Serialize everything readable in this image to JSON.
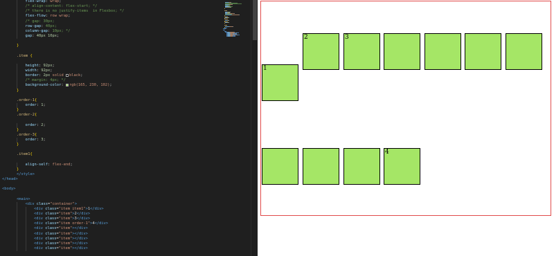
{
  "editor": {
    "lines": [
      {
        "indent": 2,
        "parts": [
          [
            "prop",
            "flex-wrap"
          ],
          [
            "pun",
            ": "
          ],
          [
            "val",
            "wrap"
          ],
          [
            "pun",
            ";"
          ]
        ]
      },
      {
        "indent": 2,
        "parts": [
          [
            "com",
            "/* align-content: flex-start; */"
          ]
        ]
      },
      {
        "indent": 2,
        "parts": [
          [
            "com",
            "/* there is no justify-items  in Flexbox; */"
          ]
        ]
      },
      {
        "indent": 2,
        "parts": [
          [
            "prop",
            "flex-flow"
          ],
          [
            "pun",
            ": "
          ],
          [
            "val",
            "row wrap"
          ],
          [
            "pun",
            ";"
          ]
        ]
      },
      {
        "indent": 2,
        "parts": [
          [
            "com",
            "/* gap: 30px;"
          ]
        ]
      },
      {
        "indent": 2,
        "parts": [
          [
            "prop",
            "row-gap"
          ],
          [
            "pun",
            ": "
          ],
          [
            "com",
            "40px;"
          ]
        ]
      },
      {
        "indent": 2,
        "parts": [
          [
            "prop",
            "column-gap"
          ],
          [
            "pun",
            ": "
          ],
          [
            "com",
            "10px; */"
          ]
        ]
      },
      {
        "indent": 2,
        "parts": [
          [
            "prop",
            "gap"
          ],
          [
            "pun",
            ": "
          ],
          [
            "num",
            "40px 10px"
          ],
          [
            "pun",
            ";"
          ]
        ]
      },
      {
        "indent": 0,
        "parts": []
      },
      {
        "indent": 1,
        "parts": [
          [
            "brace",
            "}"
          ]
        ]
      },
      {
        "indent": 0,
        "parts": []
      },
      {
        "indent": 1,
        "parts": [
          [
            "sel",
            ".item"
          ],
          [
            "pun",
            " "
          ],
          [
            "brace",
            "{"
          ]
        ]
      },
      {
        "indent": 0,
        "parts": []
      },
      {
        "indent": 2,
        "parts": [
          [
            "prop",
            "height"
          ],
          [
            "pun",
            ": "
          ],
          [
            "num",
            "92px"
          ],
          [
            "pun",
            ";"
          ]
        ]
      },
      {
        "indent": 2,
        "parts": [
          [
            "prop",
            "width"
          ],
          [
            "pun",
            ": "
          ],
          [
            "num",
            "92px"
          ],
          [
            "pun",
            ";"
          ]
        ]
      },
      {
        "indent": 2,
        "parts": [
          [
            "prop",
            "border"
          ],
          [
            "pun",
            ": "
          ],
          [
            "num",
            "2px"
          ],
          [
            "pun",
            " "
          ],
          [
            "val",
            "solid "
          ],
          [
            "swatch",
            "#000000"
          ],
          [
            "val",
            "black"
          ],
          [
            "pun",
            ";"
          ]
        ]
      },
      {
        "indent": 2,
        "parts": [
          [
            "com",
            "/* margin: 4px; */"
          ]
        ]
      },
      {
        "indent": 2,
        "parts": [
          [
            "prop",
            "background-color"
          ],
          [
            "pun",
            ": "
          ],
          [
            "swatch",
            "#a5e666"
          ],
          [
            "val",
            "rgb(165, 230, 102)"
          ],
          [
            "pun",
            ";"
          ]
        ]
      },
      {
        "indent": 1,
        "parts": [
          [
            "brace",
            "}"
          ]
        ]
      },
      {
        "indent": 0,
        "parts": []
      },
      {
        "indent": 1,
        "parts": [
          [
            "sel",
            ".order-1"
          ],
          [
            "brace",
            "{"
          ]
        ]
      },
      {
        "indent": 2,
        "parts": [
          [
            "prop",
            "order"
          ],
          [
            "pun",
            ": "
          ],
          [
            "num",
            "1"
          ],
          [
            "pun",
            ";"
          ]
        ]
      },
      {
        "indent": 1,
        "parts": [
          [
            "brace",
            "}"
          ]
        ]
      },
      {
        "indent": 1,
        "parts": [
          [
            "sel",
            ".order-2"
          ],
          [
            "brace",
            "{"
          ]
        ]
      },
      {
        "indent": 0,
        "parts": []
      },
      {
        "indent": 2,
        "parts": [
          [
            "prop",
            "order"
          ],
          [
            "pun",
            ": "
          ],
          [
            "num",
            "2"
          ],
          [
            "pun",
            ";"
          ]
        ]
      },
      {
        "indent": 1,
        "parts": [
          [
            "brace",
            "}"
          ]
        ]
      },
      {
        "indent": 1,
        "parts": [
          [
            "sel",
            ".order-3"
          ],
          [
            "brace",
            "{"
          ]
        ]
      },
      {
        "indent": 2,
        "parts": [
          [
            "prop",
            "order"
          ],
          [
            "pun",
            ": "
          ],
          [
            "num",
            "3"
          ],
          [
            "pun",
            ";"
          ]
        ]
      },
      {
        "indent": 1,
        "parts": [
          [
            "brace",
            "}"
          ]
        ]
      },
      {
        "indent": 0,
        "parts": []
      },
      {
        "indent": 1,
        "parts": [
          [
            "sel",
            ".item1"
          ],
          [
            "brace",
            "{"
          ]
        ]
      },
      {
        "indent": 0,
        "parts": []
      },
      {
        "indent": 2,
        "parts": [
          [
            "prop",
            "align-self"
          ],
          [
            "pun",
            ": "
          ],
          [
            "val",
            "flex-end"
          ],
          [
            "pun",
            ";"
          ]
        ]
      },
      {
        "indent": 1,
        "parts": [
          [
            "brace",
            "}"
          ]
        ]
      },
      {
        "indent": 1,
        "parts": [
          [
            "tag",
            "</style>"
          ]
        ]
      },
      {
        "indent": 0,
        "parts": [
          [
            "tag",
            "</head>"
          ]
        ]
      },
      {
        "indent": 0,
        "parts": []
      },
      {
        "indent": 0,
        "parts": [
          [
            "tag",
            "<body>"
          ]
        ]
      },
      {
        "indent": 0,
        "parts": []
      },
      {
        "indent": 1,
        "parts": [
          [
            "tag",
            "<main>"
          ]
        ]
      },
      {
        "indent": 2,
        "parts": [
          [
            "tag",
            "<div "
          ],
          [
            "attr",
            "class"
          ],
          [
            "pun",
            "="
          ],
          [
            "str",
            "\"container\""
          ],
          [
            "tag",
            ">"
          ]
        ]
      },
      {
        "indent": 3,
        "parts": [
          [
            "tag",
            "<div "
          ],
          [
            "attr",
            "class"
          ],
          [
            "pun",
            "="
          ],
          [
            "str",
            "\"item item1\""
          ],
          [
            "tag",
            ">"
          ],
          [
            "txt",
            "1"
          ],
          [
            "tag",
            "</div>"
          ]
        ]
      },
      {
        "indent": 3,
        "parts": [
          [
            "tag",
            "<div "
          ],
          [
            "attr",
            "class"
          ],
          [
            "pun",
            "="
          ],
          [
            "str",
            "\"item\""
          ],
          [
            "tag",
            ">"
          ],
          [
            "txt",
            "2"
          ],
          [
            "tag",
            "</div>"
          ]
        ]
      },
      {
        "indent": 3,
        "parts": [
          [
            "tag",
            "<div "
          ],
          [
            "attr",
            "class"
          ],
          [
            "pun",
            "="
          ],
          [
            "str",
            "\"item\""
          ],
          [
            "tag",
            ">"
          ],
          [
            "txt",
            "3"
          ],
          [
            "tag",
            "</div>"
          ]
        ]
      },
      {
        "indent": 3,
        "parts": [
          [
            "tag",
            "<div "
          ],
          [
            "attr",
            "class"
          ],
          [
            "pun",
            "="
          ],
          [
            "str",
            "\"item order-1\""
          ],
          [
            "tag",
            ">"
          ],
          [
            "txt",
            "4"
          ],
          [
            "tag",
            "</div>"
          ]
        ]
      },
      {
        "indent": 3,
        "parts": [
          [
            "tag",
            "<div "
          ],
          [
            "attr",
            "class"
          ],
          [
            "pun",
            "="
          ],
          [
            "str",
            "\"item\""
          ],
          [
            "tag",
            "></div>"
          ]
        ]
      },
      {
        "indent": 3,
        "parts": [
          [
            "tag",
            "<div "
          ],
          [
            "attr",
            "class"
          ],
          [
            "pun",
            "="
          ],
          [
            "str",
            "\"item\""
          ],
          [
            "tag",
            "></div>"
          ]
        ]
      },
      {
        "indent": 3,
        "parts": [
          [
            "tag",
            "<div "
          ],
          [
            "attr",
            "class"
          ],
          [
            "pun",
            "="
          ],
          [
            "str",
            "\"item\""
          ],
          [
            "tag",
            "></div>"
          ]
        ]
      },
      {
        "indent": 3,
        "parts": [
          [
            "tag",
            "<div "
          ],
          [
            "attr",
            "class"
          ],
          [
            "pun",
            "="
          ],
          [
            "str",
            "\"item\""
          ],
          [
            "tag",
            "></div>"
          ]
        ]
      },
      {
        "indent": 3,
        "parts": [
          [
            "tag",
            "<div "
          ],
          [
            "attr",
            "class"
          ],
          [
            "pun",
            "="
          ],
          [
            "str",
            "\"item\""
          ],
          [
            "tag",
            "></div>"
          ]
        ]
      }
    ]
  },
  "colors": {
    "item_background": "rgb(165, 230, 102)",
    "container_border": "#e04a4a"
  },
  "preview": {
    "items": [
      {
        "label": "1"
      },
      {
        "label": "2"
      },
      {
        "label": "3"
      },
      {
        "label": ""
      },
      {
        "label": ""
      },
      {
        "label": ""
      },
      {
        "label": ""
      },
      {
        "label": ""
      },
      {
        "label": ""
      },
      {
        "label": ""
      },
      {
        "label": "4"
      }
    ]
  }
}
